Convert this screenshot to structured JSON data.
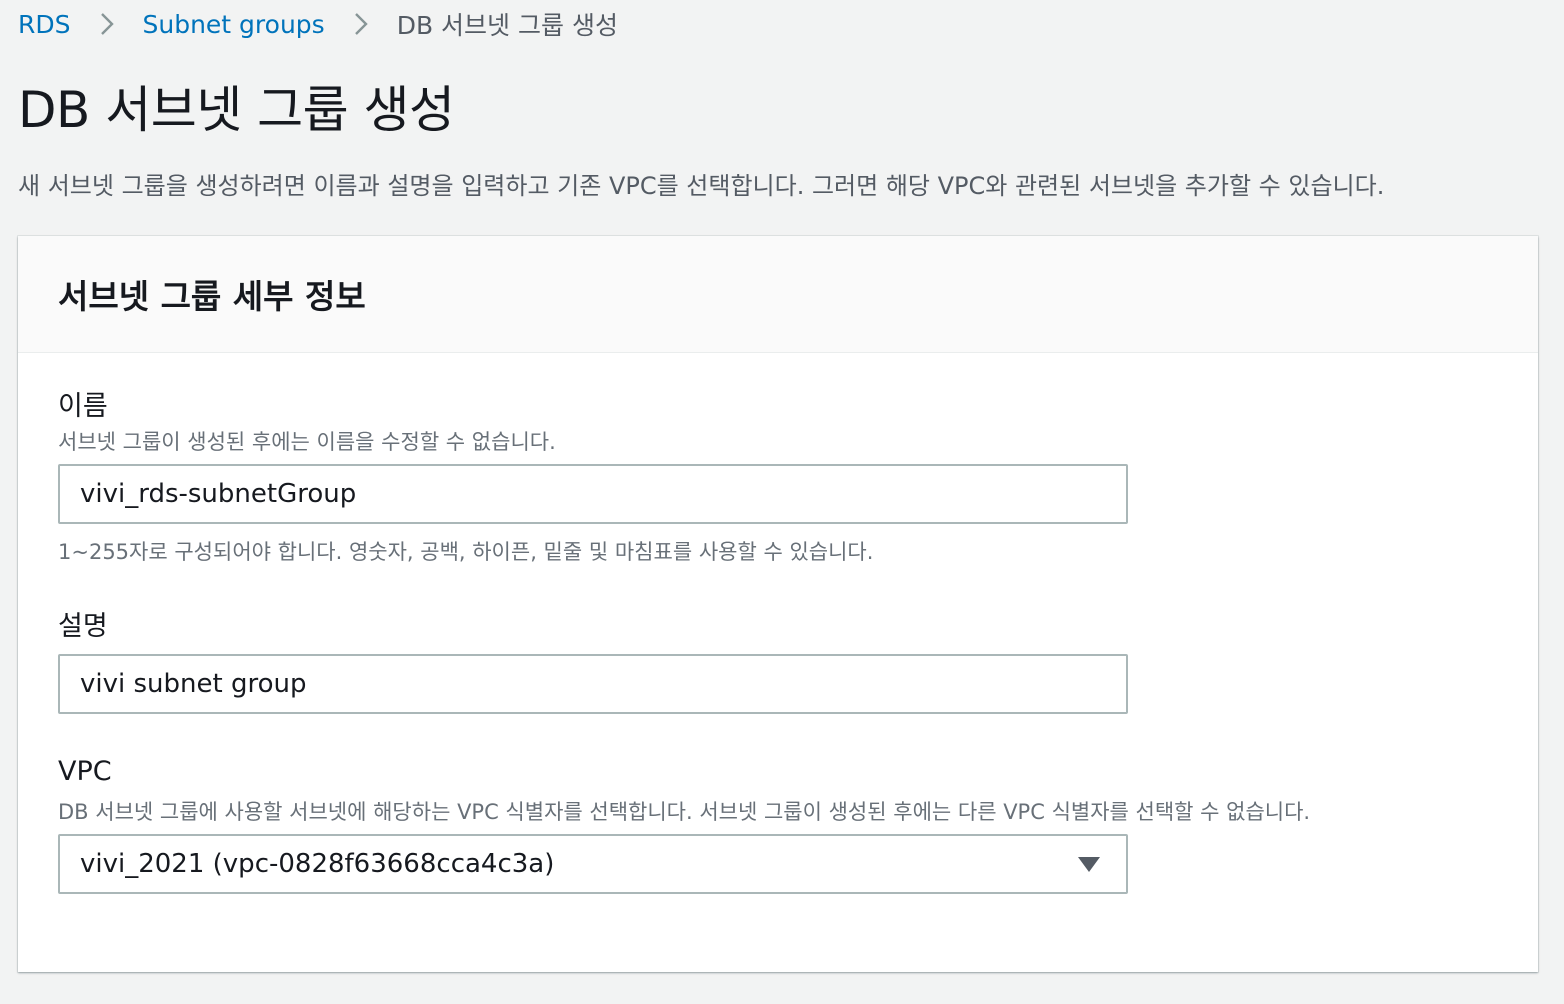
{
  "breadcrumb": {
    "items": [
      "RDS",
      "Subnet groups"
    ],
    "current": "DB 서브넷 그룹 생성"
  },
  "page": {
    "title": "DB 서브넷 그룹 생성",
    "description": "새 서브넷 그룹을 생성하려면 이름과 설명을 입력하고 기존 VPC를 선택합니다. 그러면 해당 VPC와 관련된 서브넷을 추가할 수 있습니다."
  },
  "panel": {
    "title": "서브넷 그룹 세부 정보",
    "name_field": {
      "label": "이름",
      "description": "서브넷 그룹이 생성된 후에는 이름을 수정할 수 없습니다.",
      "value": "vivi_rds-subnetGroup",
      "constraint": "1~255자로 구성되어야 합니다. 영숫자, 공백, 하이픈, 밑줄 및 마침표를 사용할 수 있습니다."
    },
    "description_field": {
      "label": "설명",
      "value": "vivi subnet group"
    },
    "vpc_field": {
      "label": "VPC",
      "description": "DB 서브넷 그룹에 사용할 서브넷에 해당하는 VPC 식별자를 선택합니다. 서브넷 그룹이 생성된 후에는 다른 VPC 식별자를 선택할 수 없습니다.",
      "selected": "vivi_2021 (vpc-0828f63668cca4c3a)",
      "icon": "caret-down-icon"
    }
  },
  "colors": {
    "link": "#0073bb",
    "text": "#16191f",
    "secondary_text": "#545b64",
    "background": "#f2f3f3",
    "input_border": "#aab7b8"
  }
}
